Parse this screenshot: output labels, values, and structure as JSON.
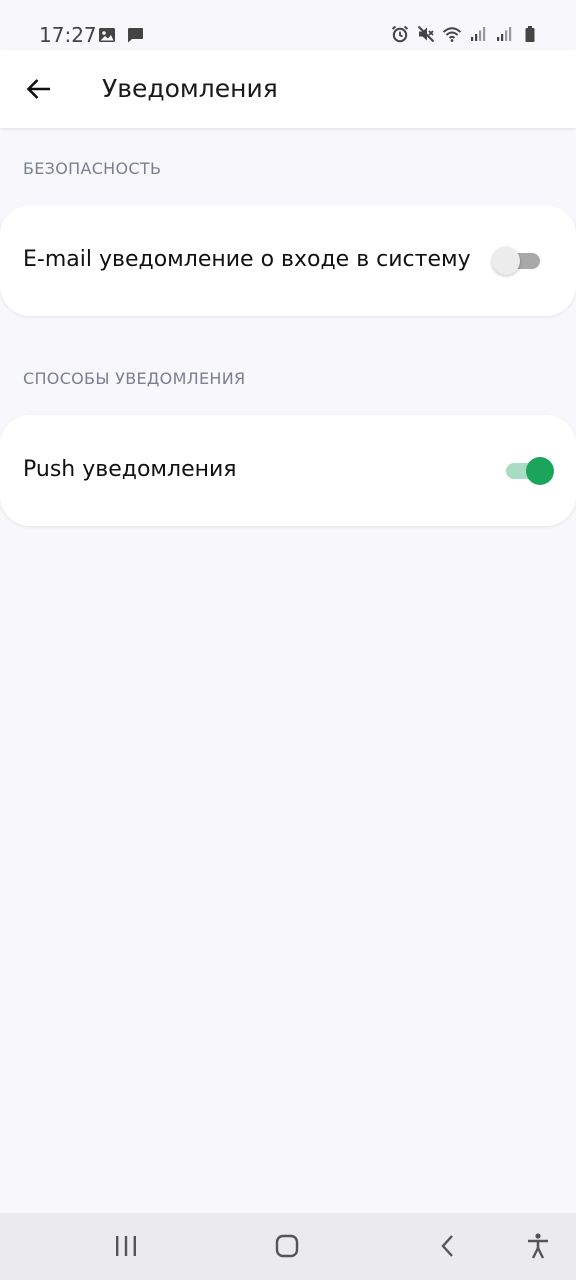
{
  "status_bar": {
    "time": "17:27",
    "left_icons": [
      "image-icon",
      "message-icon"
    ],
    "right_icons": [
      "alarm-icon",
      "mute-icon",
      "wifi-icon",
      "signal-icon",
      "signal-icon",
      "battery-icon"
    ]
  },
  "app_bar": {
    "title": "Уведомления",
    "back_icon": "arrow-left-icon"
  },
  "sections": [
    {
      "header": "БЕЗОПАСНОСТЬ",
      "item": {
        "label": "E-mail уведомление о входе в систему",
        "enabled": false
      }
    },
    {
      "header": "СПОСОБЫ УВЕДОМЛЕНИЯ",
      "item": {
        "label": "Push уведомления",
        "enabled": true
      }
    }
  ],
  "nav_bar": {
    "buttons": [
      "recents-icon",
      "home-icon",
      "back-icon",
      "accessibility-icon"
    ]
  },
  "colors": {
    "accent": "#1aa55b",
    "accent_track": "#a8dcc3",
    "background": "#f8f8fc",
    "card": "#ffffff"
  }
}
